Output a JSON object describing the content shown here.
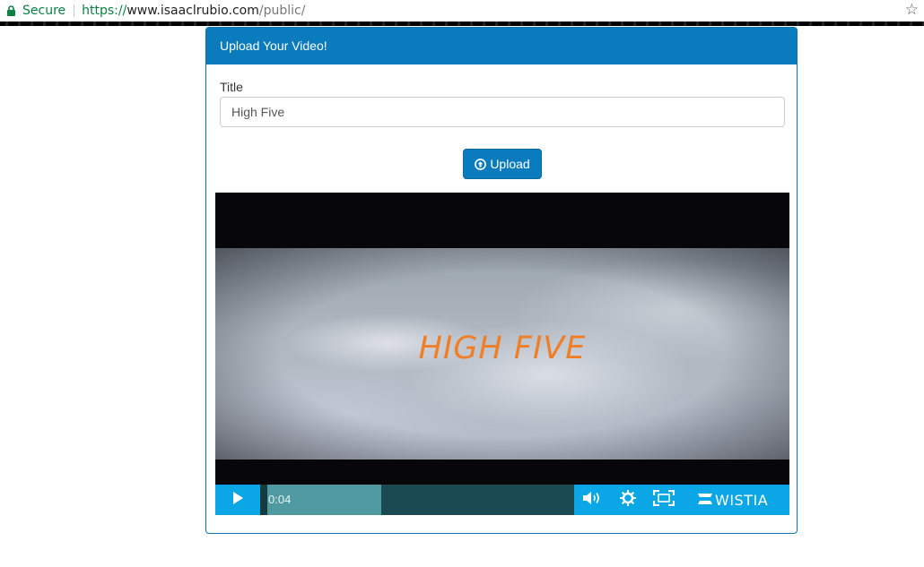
{
  "browser": {
    "secure_label": "Secure",
    "url_scheme": "https://",
    "url_host": "www.isaaclrubio.com",
    "url_path": "/public/"
  },
  "panel": {
    "heading": "Upload Your Video!",
    "title_label": "Title",
    "title_value": "High Five",
    "upload_button": "Upload"
  },
  "player": {
    "video_title_overlay": "HIGH FIVE",
    "current_time": "0:04",
    "progress_fraction": 0.37,
    "brand": "WISTIA",
    "accent_color": "#0aa6e6"
  },
  "icons": {
    "lock": "lock-icon",
    "star": "star-icon",
    "upload": "upload-circle-icon",
    "play": "play-icon",
    "volume": "volume-icon",
    "settings": "gear-icon",
    "fullscreen": "fullscreen-icon"
  }
}
